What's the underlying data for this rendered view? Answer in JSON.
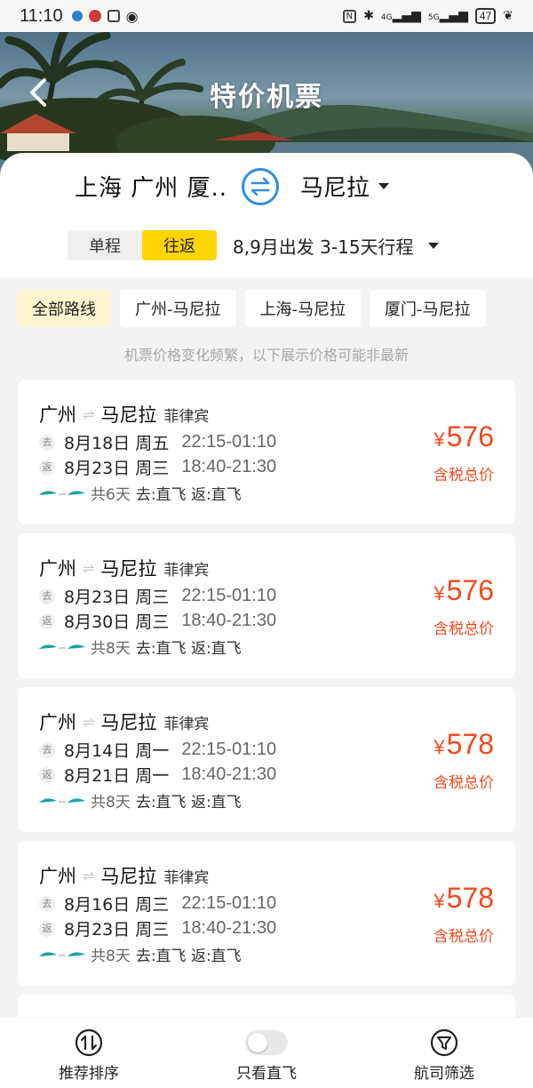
{
  "status_bar": {
    "time": "11:10",
    "network_1": "4G",
    "network_2": "5G",
    "battery": "47"
  },
  "header": {
    "title": "特价机票",
    "back_icon": "chevron-left-icon"
  },
  "route": {
    "from_cities": "上海 广州 厦..",
    "to_city": "马尼拉",
    "swap_icon": "swap-icon"
  },
  "trip": {
    "one_way": "单程",
    "round_trip": "往返",
    "selected": "往返",
    "info": "8,9月出发 3-15天行程"
  },
  "chips": [
    "全部路线",
    "广州-马尼拉",
    "上海-马尼拉",
    "厦门-马尼拉"
  ],
  "notice": "机票价格变化频繁，以下展示价格可能非最新",
  "flights": [
    {
      "from": "广州",
      "to": "马尼拉",
      "country": "菲律宾",
      "out_tag": "去",
      "out_date": "8月18日 周五",
      "out_time": "22:15-01:10",
      "ret_tag": "返",
      "ret_date": "8月23日 周三",
      "ret_time": "18:40-21:30",
      "days": "共6天",
      "direct": "去:直飞 返:直飞",
      "price": "576",
      "price_label": "含税总价"
    },
    {
      "from": "广州",
      "to": "马尼拉",
      "country": "菲律宾",
      "out_tag": "去",
      "out_date": "8月23日 周三",
      "out_time": "22:15-01:10",
      "ret_tag": "返",
      "ret_date": "8月30日 周三",
      "ret_time": "18:40-21:30",
      "days": "共8天",
      "direct": "去:直飞 返:直飞",
      "price": "576",
      "price_label": "含税总价"
    },
    {
      "from": "广州",
      "to": "马尼拉",
      "country": "菲律宾",
      "out_tag": "去",
      "out_date": "8月14日 周一",
      "out_time": "22:15-01:10",
      "ret_tag": "返",
      "ret_date": "8月21日 周一",
      "ret_time": "18:40-21:30",
      "days": "共8天",
      "direct": "去:直飞 返:直飞",
      "price": "578",
      "price_label": "含税总价"
    },
    {
      "from": "广州",
      "to": "马尼拉",
      "country": "菲律宾",
      "out_tag": "去",
      "out_date": "8月16日 周三",
      "out_time": "22:15-01:10",
      "ret_tag": "返",
      "ret_date": "8月23日 周三",
      "ret_time": "18:40-21:30",
      "days": "共8天",
      "direct": "去:直飞 返:直飞",
      "price": "578",
      "price_label": "含税总价"
    }
  ],
  "currency": "¥",
  "bottom_bar": {
    "sort": "推荐排序",
    "direct_only": "只看直飞",
    "direct_only_on": false,
    "airline_filter": "航司筛选"
  },
  "colors": {
    "accent_yellow": "#ffd401",
    "price_red": "#f14a1c",
    "swap_blue": "#2f8ee0"
  }
}
